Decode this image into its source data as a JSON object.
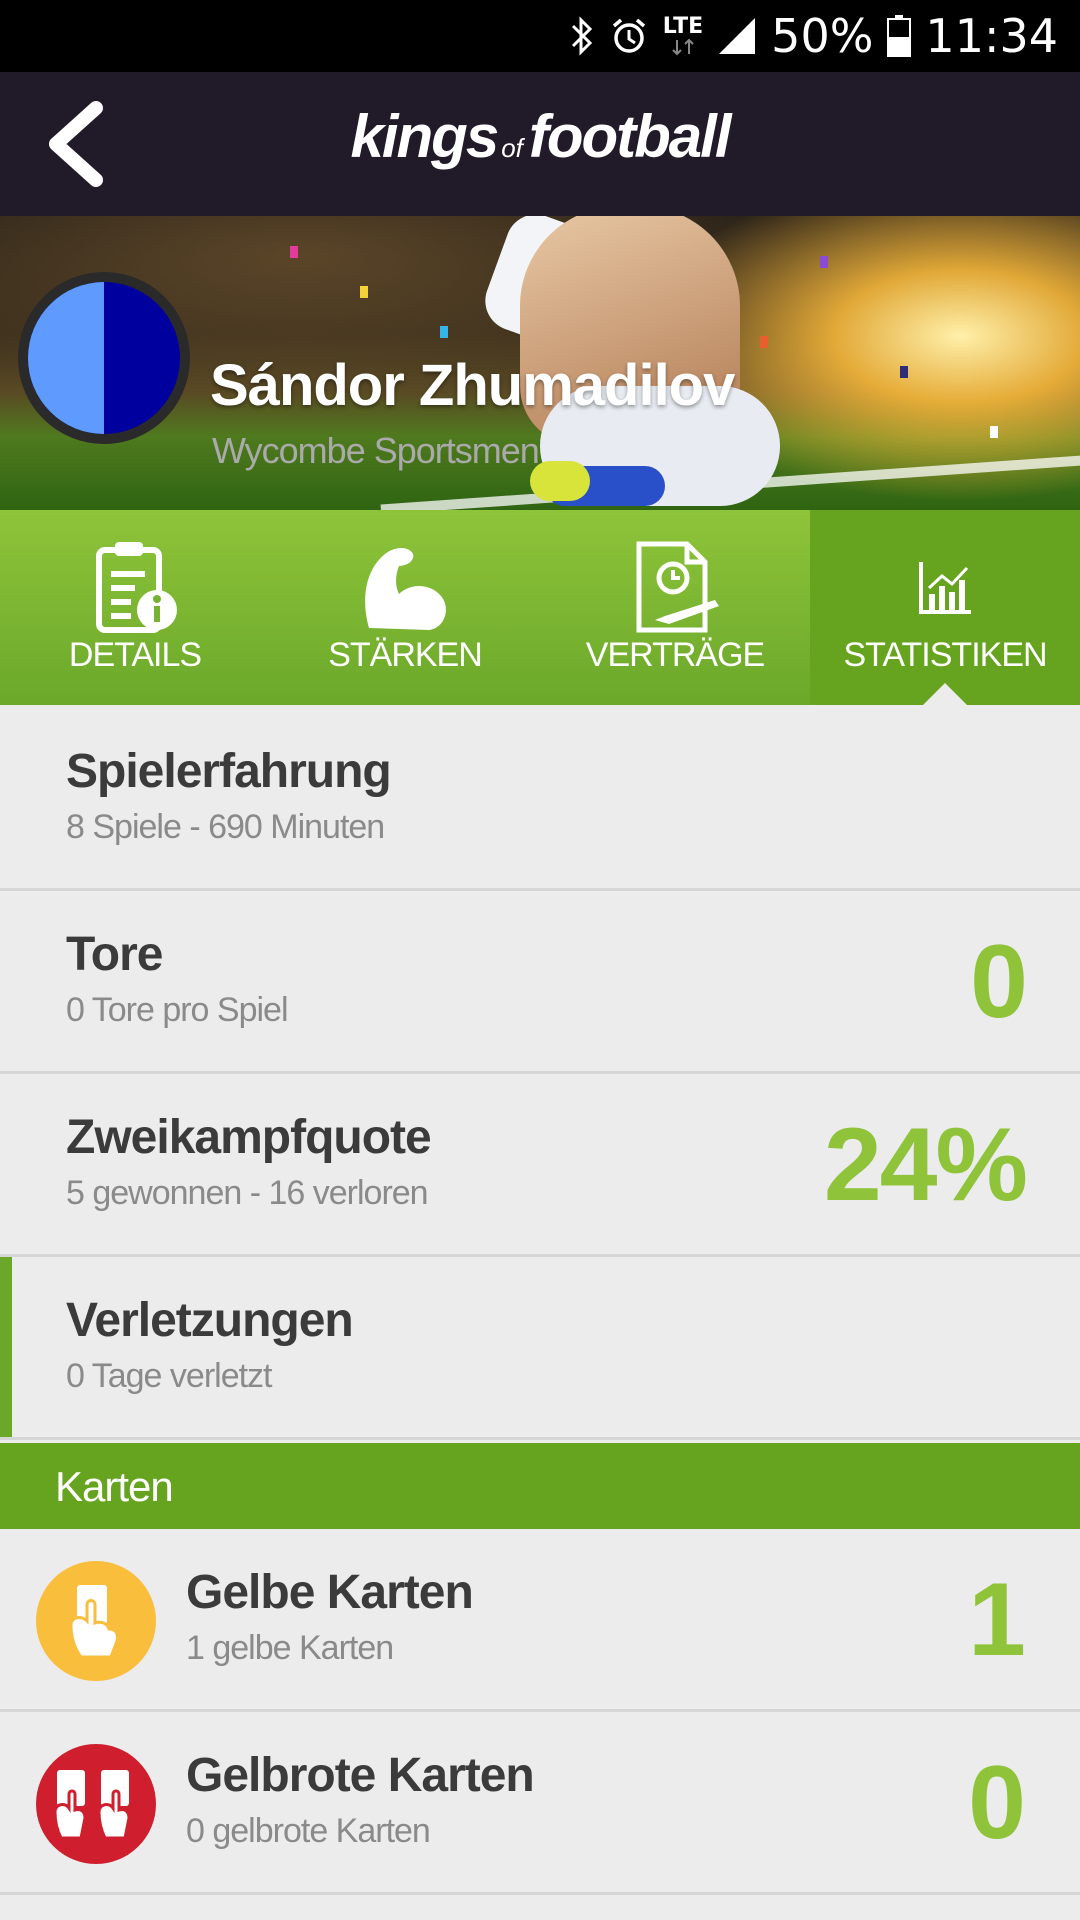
{
  "status_bar": {
    "network": "LTE",
    "battery": "50%",
    "time": "11:34"
  },
  "app_bar": {
    "brand_part1": "kings",
    "brand_of": "of",
    "brand_part2": "football"
  },
  "player": {
    "name": "Sándor Zhumadilov",
    "club": "Wycombe Sportsmen",
    "crest_colors": [
      "#5f9bff",
      "#00009e"
    ]
  },
  "tabs": [
    {
      "label": "DETAILS",
      "icon": "details-document-icon",
      "active": false
    },
    {
      "label": "STÄRKEN",
      "icon": "bicep-icon",
      "active": false
    },
    {
      "label": "VERTRÄGE",
      "icon": "contract-icon",
      "active": false
    },
    {
      "label": "STATISTIKEN",
      "icon": "chart-icon",
      "active": true
    }
  ],
  "stats": [
    {
      "title": "Spielerfahrung",
      "subtitle": "8 Spiele - 690 Minuten",
      "value": ""
    },
    {
      "title": "Tore",
      "subtitle": "0 Tore pro Spiel",
      "value": "0"
    },
    {
      "title": "Zweikampfquote",
      "subtitle": "5 gewonnen - 16 verloren",
      "value": "24%"
    },
    {
      "title": "Verletzungen",
      "subtitle": "0 Tage verletzt",
      "value": ""
    }
  ],
  "cards_section": {
    "title": "Karten",
    "items": [
      {
        "title": "Gelbe Karten",
        "subtitle": "1 gelbe Karten",
        "value": "1",
        "icon": "yellow-card-icon",
        "color": "#f9be3c"
      },
      {
        "title": "Gelbrote Karten",
        "subtitle": "0 gelbrote Karten",
        "value": "0",
        "icon": "yellow-red-card-icon",
        "color": "#cf1f2e"
      }
    ]
  },
  "colors": {
    "accent_green": "#8fc33a",
    "tab_green": "#66a41f",
    "app_bar": "#211b29"
  }
}
